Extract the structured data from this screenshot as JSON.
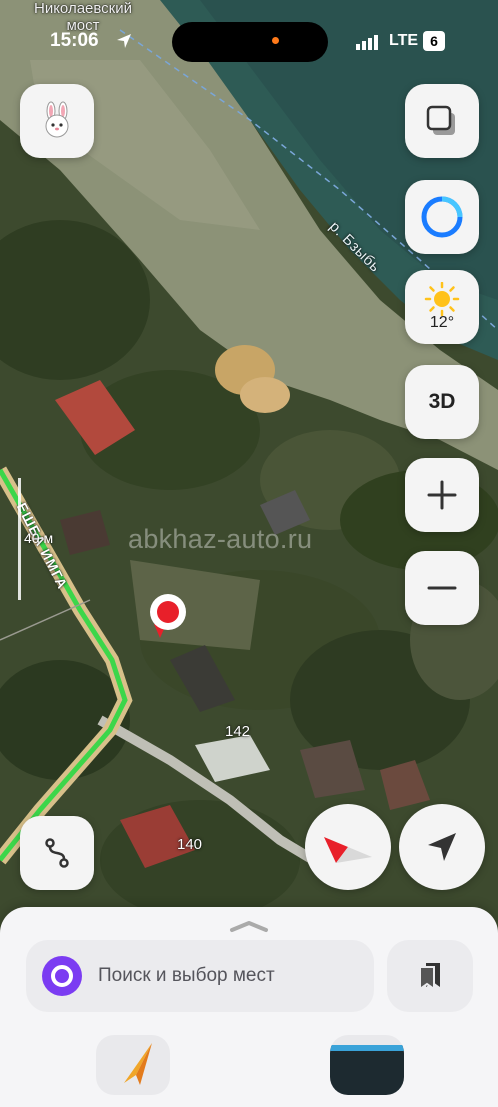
{
  "status_bar": {
    "time": "15:06",
    "network": "LTE",
    "battery": "6"
  },
  "map": {
    "bridge_label": "Николаевский мост",
    "river_label": "р. Бзыбь",
    "road_label": "ЕШБА ИМГА",
    "scale_label": "40 м",
    "house_numbers": [
      "142",
      "140"
    ],
    "watermark": "abkhaz-auto.ru"
  },
  "controls": {
    "three_d_label": "3D",
    "weather_temp": "12°",
    "weather_icon": "sun-icon",
    "zoom_in_icon": "plus-icon",
    "zoom_out_icon": "minus-icon"
  },
  "search": {
    "placeholder": "Поиск и выбор мест"
  },
  "colors": {
    "accent_purple": "#7b3cf2",
    "pin_red": "#e8202a",
    "route_green": "#3cd64a",
    "alice_blue": "#1a7cff"
  }
}
